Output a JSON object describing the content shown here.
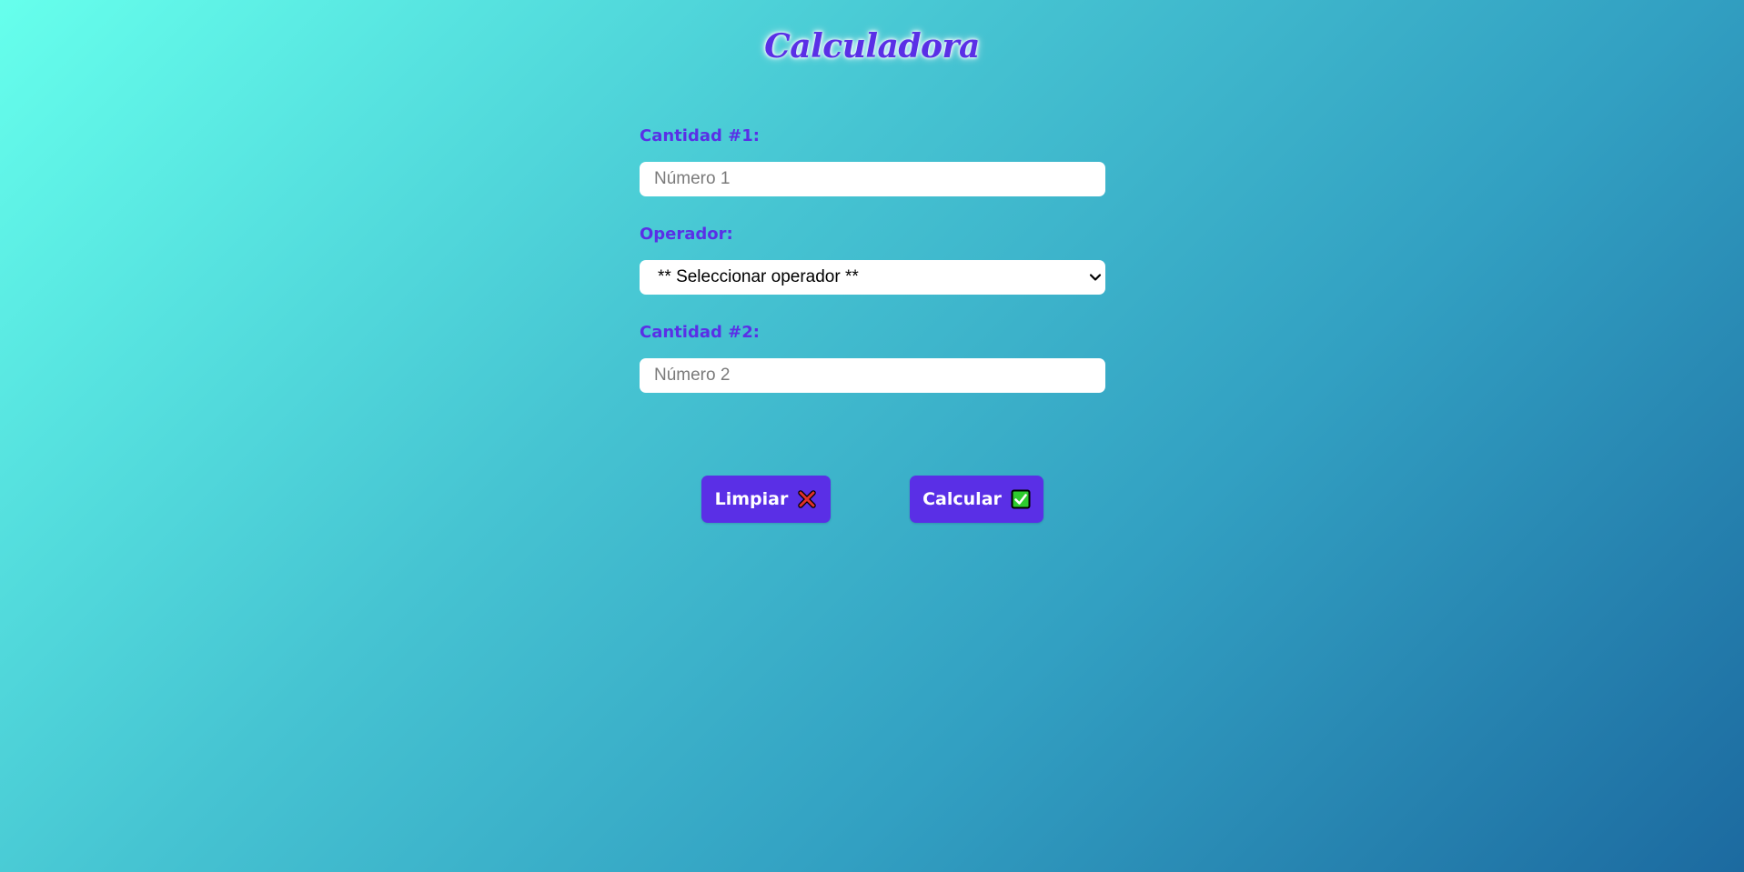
{
  "header": {
    "title": "Calculadora"
  },
  "form": {
    "quantity1": {
      "label": "Cantidad #1:",
      "placeholder": "Número 1",
      "value": ""
    },
    "operator": {
      "label": "Operador:",
      "selected": "** Seleccionar operador **"
    },
    "quantity2": {
      "label": "Cantidad #2:",
      "placeholder": "Número 2",
      "value": ""
    }
  },
  "actions": {
    "clear_label": "Limpiar",
    "clear_icon": "cross-mark-icon",
    "calculate_label": "Calcular",
    "calculate_icon": "check-mark-icon"
  },
  "colors": {
    "accent": "#5a2fe6",
    "background_start": "#66ffec",
    "background_end": "#1c6aa0",
    "clear_icon": "#e0322a",
    "calculate_icon": "#2ecc2e"
  }
}
